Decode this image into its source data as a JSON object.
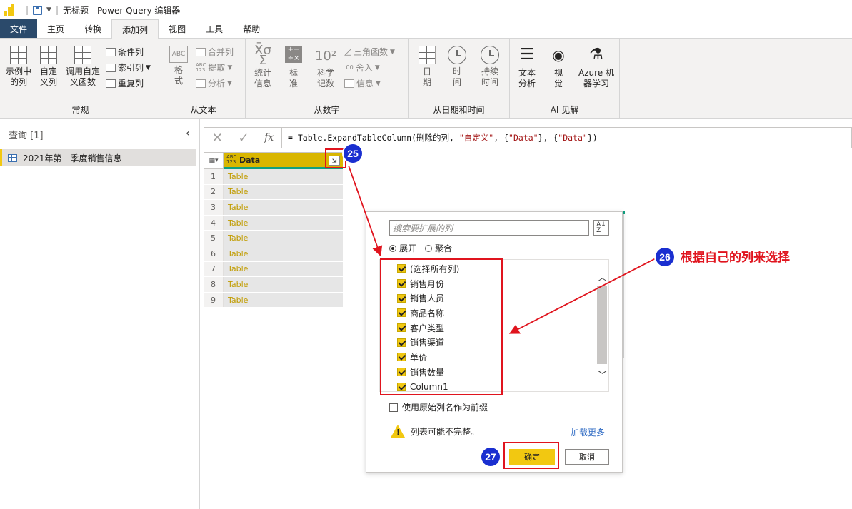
{
  "title_bar": {
    "document_title": "无标题 - Power Query 编辑器"
  },
  "menu": {
    "tabs": [
      {
        "label": "文件"
      },
      {
        "label": "主页"
      },
      {
        "label": "转换"
      },
      {
        "label": "添加列"
      },
      {
        "label": "视图"
      },
      {
        "label": "工具"
      },
      {
        "label": "帮助"
      }
    ],
    "active_tab": "添加列"
  },
  "ribbon": {
    "general": {
      "label": "常规",
      "example_col": "示例中\n的列",
      "custom_col": "自定\n义列",
      "invoke_fn": "调用自定\n义函数",
      "conditional_col": "条件列",
      "index_col": "索引列",
      "duplicate_col": "重复列"
    },
    "from_text": {
      "label": "从文本",
      "format": "格\n式",
      "merge_cols": "合并列",
      "extract": "提取",
      "parse": "分析"
    },
    "from_number": {
      "label": "从数字",
      "statistics": "统计\n信息",
      "standard": "标\n准",
      "scientific": "科学\n记数",
      "trigonometry": "三角函数",
      "rounding": "舍入",
      "information": "信息"
    },
    "from_datetime": {
      "label": "从日期和时间",
      "date": "日\n期",
      "time": "时\n间",
      "duration": "持续\n时间"
    },
    "ai_insights": {
      "label": "AI 见解",
      "text_analytics": "文本\n分析",
      "vision": "视\n觉",
      "azure_ml": "Azure 机\n器学习"
    }
  },
  "queries_pane": {
    "header": "查询 [1]",
    "items": [
      {
        "name": "2021年第一季度销售信息"
      }
    ]
  },
  "formula_bar": {
    "prefix": "= Table.ExpandTableColumn(删除的列, ",
    "arg1": "\"自定义\"",
    "mid1": ", {",
    "arg2": "\"Data\"",
    "mid2": "}, {",
    "arg3": "\"Data\"",
    "suffix": "})"
  },
  "grid": {
    "column_header": "Data",
    "type_icon": "ABC 123",
    "rows": [
      {
        "num": "1",
        "value": "Table"
      },
      {
        "num": "2",
        "value": "Table"
      },
      {
        "num": "3",
        "value": "Table"
      },
      {
        "num": "4",
        "value": "Table"
      },
      {
        "num": "5",
        "value": "Table"
      },
      {
        "num": "6",
        "value": "Table"
      },
      {
        "num": "7",
        "value": "Table"
      },
      {
        "num": "8",
        "value": "Table"
      },
      {
        "num": "9",
        "value": "Table"
      }
    ]
  },
  "expand_dialog": {
    "search_placeholder": "搜索要扩展的列",
    "radio_expand": "展开",
    "radio_aggregate": "聚合",
    "columns": [
      {
        "label": "(选择所有列)",
        "checked": true
      },
      {
        "label": "销售月份",
        "checked": true
      },
      {
        "label": "销售人员",
        "checked": true
      },
      {
        "label": "商品名称",
        "checked": true
      },
      {
        "label": "客户类型",
        "checked": true
      },
      {
        "label": "销售渠道",
        "checked": true
      },
      {
        "label": "单价",
        "checked": true
      },
      {
        "label": "销售数量",
        "checked": true
      },
      {
        "label": "Column1",
        "checked": true
      }
    ],
    "use_prefix_label": "使用原始列名作为前缀",
    "warning_text": "列表可能不完整。",
    "load_more": "加载更多",
    "ok_label": "确定",
    "cancel_label": "取消"
  },
  "annotations": {
    "step25": "25",
    "step26": "26",
    "step27": "27",
    "step26_text": "根据自己的列来选择"
  },
  "colors": {
    "accent_yellow": "#f2c811",
    "annotation_red": "#e0141e",
    "badge_blue": "#1a2fd0"
  }
}
